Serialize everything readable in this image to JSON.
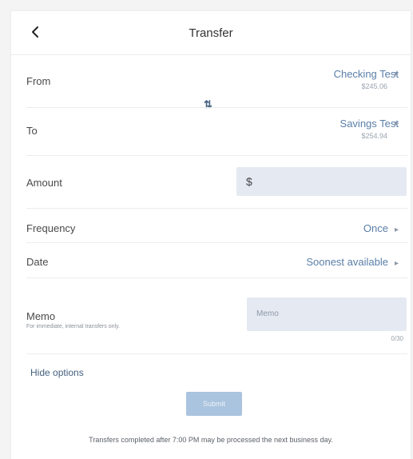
{
  "header": {
    "title": "Transfer",
    "back_icon": "chevron-left-icon"
  },
  "from": {
    "label": "From",
    "account_name": "Checking Test",
    "account_balance": "$245.06"
  },
  "swap_icon": "swap-vertical-icon",
  "to": {
    "label": "To",
    "account_name": "Savings Test",
    "account_balance": "$254.94"
  },
  "amount": {
    "label": "Amount",
    "currency_symbol": "$",
    "value": ""
  },
  "frequency": {
    "label": "Frequency",
    "value": "Once"
  },
  "date": {
    "label": "Date",
    "value": "Soonest available"
  },
  "memo": {
    "label": "Memo",
    "sublabel": "For immediate, internal transfers only.",
    "placeholder": "Memo",
    "counter": "0/30"
  },
  "hide_options": "Hide options",
  "submit_label": "Submit",
  "footnote": "Transfers completed after 7:00 PM may be processed the next business day.",
  "colors": {
    "link": "#5a7ea8",
    "input_bg": "#e5e9f2",
    "submit_bg": "#aac3de"
  }
}
